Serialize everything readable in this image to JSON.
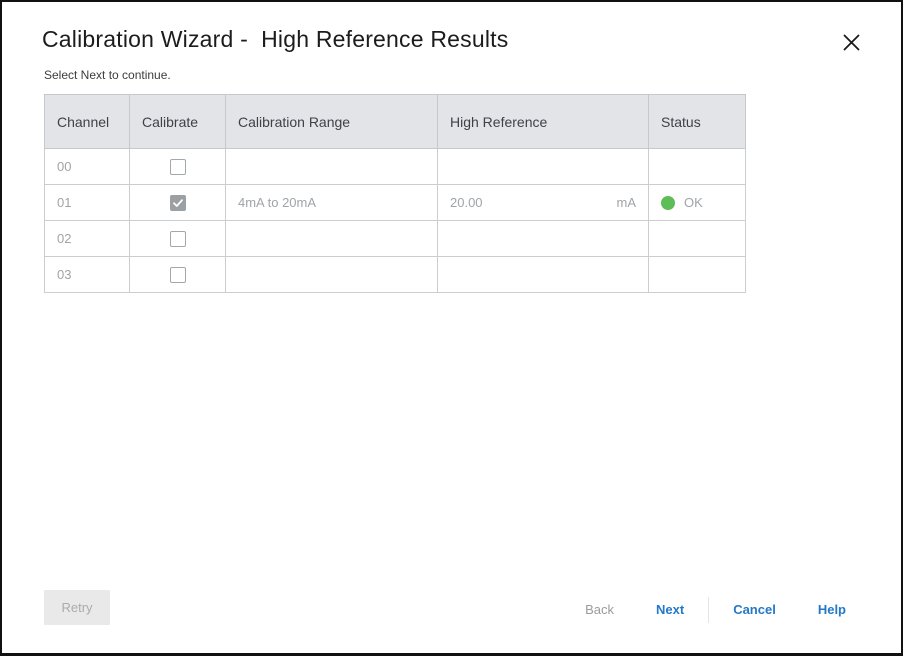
{
  "dialog": {
    "title": "Calibration Wizard -  High Reference Results",
    "subtitle": "Select Next to continue."
  },
  "table": {
    "headers": [
      "Channel",
      "Calibrate",
      "Calibration Range",
      "High Reference",
      "Status"
    ],
    "rows": [
      {
        "channel": "00",
        "calibrate_checked": false,
        "range": "",
        "high_ref_value": "",
        "high_ref_unit": "",
        "status_ok": false,
        "status_label": ""
      },
      {
        "channel": "01",
        "calibrate_checked": true,
        "range": "4mA to 20mA",
        "high_ref_value": "20.00",
        "high_ref_unit": "mA",
        "status_ok": true,
        "status_label": "OK"
      },
      {
        "channel": "02",
        "calibrate_checked": false,
        "range": "",
        "high_ref_value": "",
        "high_ref_unit": "",
        "status_ok": false,
        "status_label": ""
      },
      {
        "channel": "03",
        "calibrate_checked": false,
        "range": "",
        "high_ref_value": "",
        "high_ref_unit": "",
        "status_ok": false,
        "status_label": ""
      }
    ]
  },
  "footer": {
    "retry_label": "Retry",
    "back_label": "Back",
    "next_label": "Next",
    "cancel_label": "Cancel",
    "help_label": "Help"
  },
  "colors": {
    "status_ok_green": "#5dbe58",
    "link_blue": "#2478c8",
    "header_bg": "#e2e4e7",
    "checked_checkbox_gray": "#9ba0a5"
  }
}
